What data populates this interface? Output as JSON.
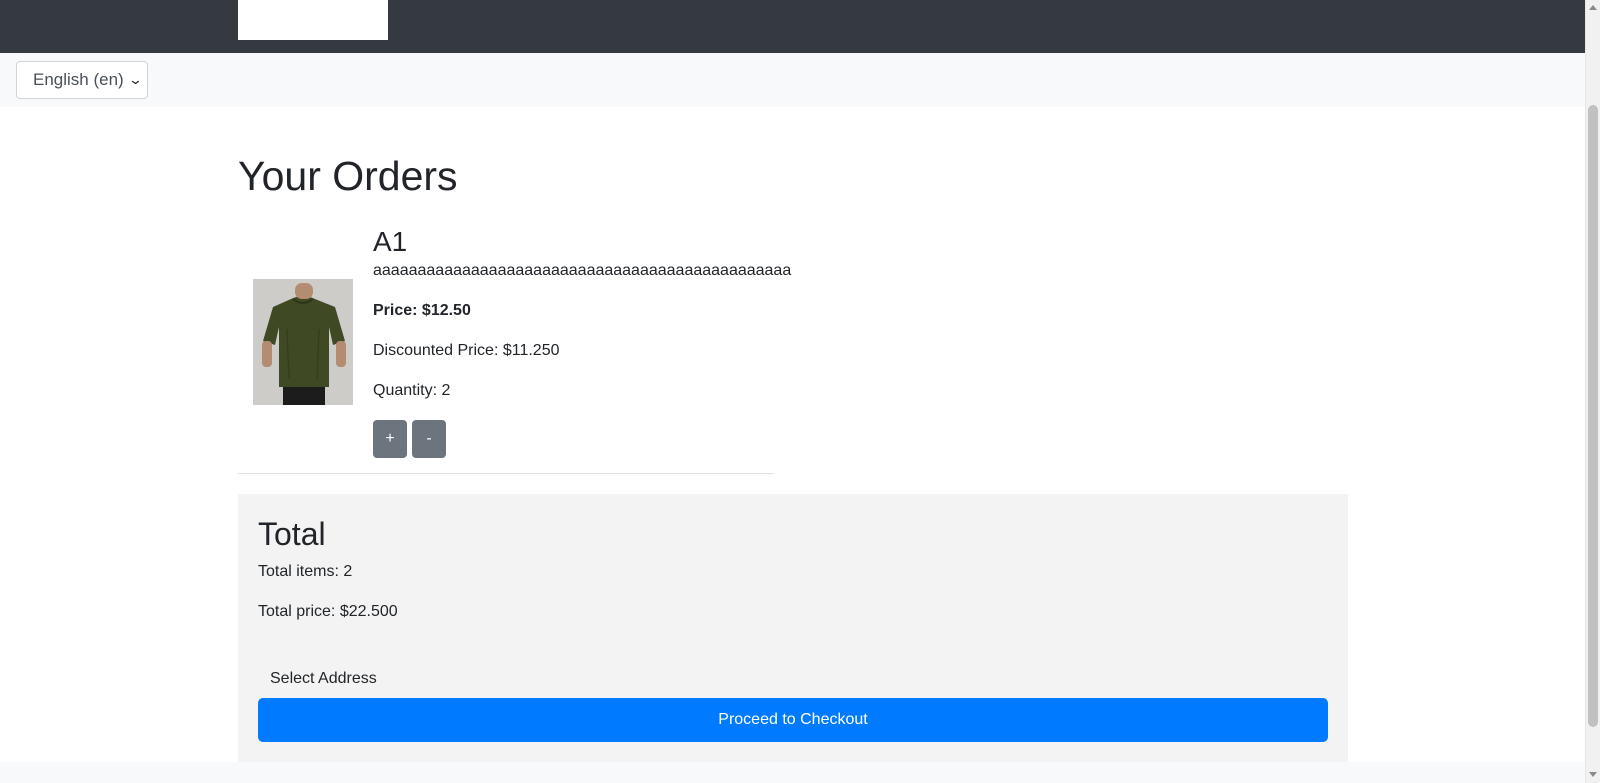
{
  "language": {
    "selected": "English (en)"
  },
  "page": {
    "title": "Your Orders"
  },
  "order": {
    "name": "A1",
    "description": "aaaaaaaaaaaaaaaaaaaaaaaaaaaaaaaaaaaaaaaaaaaaaaa",
    "price_text": "Price: $12.50",
    "discounted_price_text": "Discounted Price: $11.250",
    "quantity_text": "Quantity: 2",
    "increase_label": "+",
    "decrease_label": "-",
    "image_icon": "olive-t-shirt-photo"
  },
  "total": {
    "title": "Total",
    "items_text": "Total items: 2",
    "price_text": "Total price: $22.500",
    "select_address_label": "Select Address",
    "checkout_label": "Proceed to Checkout"
  },
  "colors": {
    "navbar": "#343a40",
    "primary": "#007bff",
    "secondary": "#6c757d",
    "panel": "#f3f3f3"
  }
}
